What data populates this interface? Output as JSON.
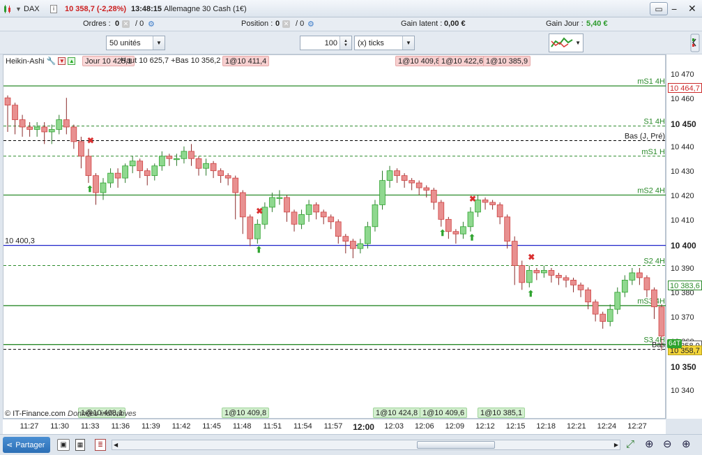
{
  "titlebar": {
    "instrument": "DAX",
    "price_change": "10 358,7 (-2,28%)",
    "time": "13:48:15",
    "name": "Allemagne 30 Cash (1€)"
  },
  "posbar": {
    "orders_label": "Ordres :",
    "orders_value": "0",
    "orders_total": "/ 0",
    "position_label": "Position :",
    "position_value": "0",
    "position_total": "/ 0",
    "gain_latent_label": "Gain latent :",
    "gain_latent_value": "0,00 €",
    "gain_jour_label": "Gain Jour :",
    "gain_jour_value": "5,40 €"
  },
  "controls": {
    "units_select": "50 unités",
    "quantity_value": "100",
    "ticks_select": "(x) ticks"
  },
  "chart_header": {
    "indicator": "Heikin-Ashi",
    "overlay_text": "Jour 10 425,1",
    "overlay_text2": "Haut 10 625,7 +Bas 10 356,2",
    "sell_tags": [
      "1@10 411,4",
      "1@10 409,8",
      "1@10 422,6",
      "1@10 385,9"
    ],
    "buy_tags": [
      "1@10 408,1",
      "1@10 409,8",
      "1@10 424,8",
      "1@10 409,6",
      "1@10 385,1"
    ]
  },
  "levels": [
    {
      "label": "mS1 4H",
      "value": 10465.9,
      "color": "#2a8a2a",
      "style": "solid"
    },
    {
      "label": "S1 4H",
      "value": 10449.4,
      "color": "#2a8a2a",
      "style": "dashed"
    },
    {
      "label": "Bas (J, Pré)",
      "value": 10443.4,
      "color": "#000000",
      "style": "dashed"
    },
    {
      "label": "mS1 H",
      "value": 10437.0,
      "color": "#2a8a2a",
      "style": "dashed"
    },
    {
      "label": "mS2 4H",
      "value": 10421.0,
      "color": "#2a8a2a",
      "style": "solid"
    },
    {
      "label": "10 400,3",
      "value": 10400.3,
      "color": "#1f24c9",
      "style": "solid"
    },
    {
      "label": "S2 4H",
      "value": 10392.0,
      "color": "#2a8a2a",
      "style": "dashed"
    },
    {
      "label": "mS3 4H",
      "value": 10375.5,
      "color": "#2a8a2a",
      "style": "solid"
    },
    {
      "label": "S3 4H",
      "value": 10359.5,
      "color": "#2a8a2a",
      "style": "solid"
    },
    {
      "label": "Bas",
      "value": 10357.5,
      "color": "#000000",
      "style": "dashed"
    }
  ],
  "yaxis": {
    "ticks": [
      "10 470",
      "10 460",
      "10 450",
      "10 440",
      "10 430",
      "10 420",
      "10 410",
      "10 400",
      "10 390",
      "10 380",
      "10 370",
      "10 360",
      "10 350",
      "10 340"
    ],
    "tick_values": [
      10470,
      10460,
      10450,
      10440,
      10430,
      10420,
      10410,
      10400,
      10390,
      10380,
      10370,
      10360,
      10350,
      10340
    ],
    "boxes": [
      {
        "text": "10 464,7",
        "value": 10464.7,
        "color": "#cc2b2b"
      },
      {
        "text": "10 383,6",
        "value": 10383.6,
        "color": "#2a8a2a"
      },
      {
        "text": "10 358,9",
        "value": 10358.9,
        "color": "#555555"
      },
      {
        "text": "10 358,7",
        "value": 10356.7,
        "color": "#555555"
      }
    ],
    "bar_count_tag": "64T"
  },
  "xaxis": {
    "labels": [
      "11:27",
      "11:30",
      "11:33",
      "11:36",
      "11:39",
      "11:42",
      "11:45",
      "11:48",
      "11:51",
      "11:54",
      "11:57",
      "12:00",
      "12:03",
      "12:06",
      "12:09",
      "12:12",
      "12:15",
      "12:18",
      "12:21",
      "12:24",
      "12:27"
    ]
  },
  "footer": {
    "copyright": "© IT-Finance.com",
    "note": "Données indicatives",
    "share_label": "Partager"
  },
  "chart_data": {
    "type": "candlestick",
    "ylim": [
      10335,
      10478
    ],
    "candles": [
      [
        10461,
        10458,
        10448,
        10462,
        10447
      ],
      [
        10458,
        10452,
        10447,
        10459,
        10446
      ],
      [
        10452,
        10449,
        10446,
        10454,
        10445
      ],
      [
        10449,
        10448,
        10446,
        10451,
        10445
      ],
      [
        10448,
        10449,
        10446,
        10451,
        10445
      ],
      [
        10449,
        10447,
        10444,
        10451,
        10442
      ],
      [
        10447,
        10448,
        10443,
        10450,
        10442
      ],
      [
        10448,
        10452,
        10447,
        10454,
        10446
      ],
      [
        10452,
        10449,
        10447,
        10461,
        10446
      ],
      [
        10449,
        10443,
        10441,
        10450,
        10440
      ],
      [
        10443,
        10437,
        10434,
        10445,
        10432
      ],
      [
        10437,
        10429,
        10427,
        10440,
        10426
      ],
      [
        10429,
        10422,
        10420,
        10430,
        10417
      ],
      [
        10422,
        10426,
        10420,
        10428,
        10419
      ],
      [
        10426,
        10430,
        10425,
        10432,
        10424
      ],
      [
        10430,
        10428,
        10425,
        10432,
        10424
      ],
      [
        10428,
        10433,
        10427,
        10434,
        10426
      ],
      [
        10433,
        10435,
        10431,
        10437,
        10430
      ],
      [
        10435,
        10431,
        10429,
        10436,
        10428
      ],
      [
        10431,
        10429,
        10426,
        10432,
        10425
      ],
      [
        10429,
        10433,
        10428,
        10434,
        10427
      ],
      [
        10433,
        10437,
        10432,
        10439,
        10431
      ],
      [
        10437,
        10436,
        10434,
        10438,
        10433
      ],
      [
        10436,
        10436,
        10434,
        10438,
        10433
      ],
      [
        10436,
        10439,
        10435,
        10441,
        10434
      ],
      [
        10439,
        10436,
        10434,
        10442,
        10433
      ],
      [
        10436,
        10432,
        10430,
        10437,
        10429
      ],
      [
        10432,
        10434,
        10430,
        10436,
        10429
      ],
      [
        10434,
        10431,
        10429,
        10435,
        10428
      ],
      [
        10431,
        10429,
        10427,
        10432,
        10426
      ],
      [
        10429,
        10428,
        10426,
        10430,
        10425
      ],
      [
        10428,
        10422,
        10412,
        10429,
        10411
      ],
      [
        10422,
        10412,
        10407,
        10423,
        10405
      ],
      [
        10412,
        10403,
        10401,
        10413,
        10400
      ],
      [
        10403,
        10409,
        10402,
        10411,
        10401
      ],
      [
        10409,
        10416,
        10408,
        10418,
        10407
      ],
      [
        10416,
        10420,
        10415,
        10422,
        10414
      ],
      [
        10420,
        10420,
        10418,
        10423,
        10417
      ],
      [
        10420,
        10414,
        10411,
        10421,
        10410
      ],
      [
        10414,
        10409,
        10407,
        10415,
        10406
      ],
      [
        10409,
        10413,
        10408,
        10415,
        10407
      ],
      [
        10413,
        10417,
        10411,
        10419,
        10410
      ],
      [
        10417,
        10414,
        10412,
        10418,
        10411
      ],
      [
        10414,
        10412,
        10410,
        10415,
        10409
      ],
      [
        10412,
        10410,
        10408,
        10413,
        10407
      ],
      [
        10410,
        10404,
        10402,
        10411,
        10401
      ],
      [
        10404,
        10402,
        10399,
        10405,
        10397
      ],
      [
        10402,
        10399,
        10396,
        10403,
        10395
      ],
      [
        10399,
        10401,
        10398,
        10403,
        10397
      ],
      [
        10401,
        10408,
        10400,
        10410,
        10399
      ],
      [
        10408,
        10417,
        10407,
        10419,
        10406
      ],
      [
        10417,
        10427,
        10416,
        10431,
        10415
      ],
      [
        10427,
        10431,
        10425,
        10433,
        10424
      ],
      [
        10431,
        10429,
        10427,
        10432,
        10426
      ],
      [
        10429,
        10427,
        10425,
        10430,
        10424
      ],
      [
        10427,
        10426,
        10424,
        10428,
        10423
      ],
      [
        10426,
        10424,
        10422,
        10427,
        10421
      ],
      [
        10424,
        10423,
        10421,
        10425,
        10420
      ],
      [
        10423,
        10418,
        10416,
        10424,
        10415
      ],
      [
        10418,
        10411,
        10409,
        10419,
        10408
      ],
      [
        10411,
        10406,
        10404,
        10412,
        10403
      ],
      [
        10406,
        10405,
        10402,
        10407,
        10401
      ],
      [
        10405,
        10408,
        10404,
        10410,
        10403
      ],
      [
        10408,
        10414,
        10407,
        10416,
        10406
      ],
      [
        10414,
        10419,
        10413,
        10421,
        10412
      ],
      [
        10419,
        10418,
        10416,
        10420,
        10415
      ],
      [
        10418,
        10417,
        10416,
        10419,
        10415
      ],
      [
        10417,
        10412,
        10410,
        10418,
        10409
      ],
      [
        10412,
        10402,
        10400,
        10413,
        10399
      ],
      [
        10402,
        10392,
        10389,
        10404,
        10384
      ],
      [
        10392,
        10385,
        10383,
        10394,
        10382
      ],
      [
        10385,
        10390,
        10384,
        10392,
        10383
      ],
      [
        10390,
        10389,
        10387,
        10391,
        10386
      ],
      [
        10389,
        10390,
        10388,
        10392,
        10387
      ],
      [
        10390,
        10388,
        10386,
        10391,
        10385
      ],
      [
        10388,
        10387,
        10385,
        10389,
        10384
      ],
      [
        10387,
        10386,
        10384,
        10388,
        10383
      ],
      [
        10386,
        10384,
        10382,
        10387,
        10381
      ],
      [
        10384,
        10382,
        10380,
        10385,
        10379
      ],
      [
        10382,
        10377,
        10375,
        10383,
        10374
      ],
      [
        10377,
        10372,
        10370,
        10378,
        10369
      ],
      [
        10372,
        10369,
        10367,
        10373,
        10366
      ],
      [
        10369,
        10374,
        10368,
        10376,
        10367
      ],
      [
        10374,
        10381,
        10373,
        10383,
        10372
      ],
      [
        10381,
        10386,
        10380,
        10388,
        10379
      ],
      [
        10386,
        10389,
        10385,
        10391,
        10384
      ],
      [
        10389,
        10387,
        10385,
        10391,
        10384
      ],
      [
        10387,
        10382,
        10380,
        10388,
        10379
      ],
      [
        10382,
        10375,
        10372,
        10383,
        10370
      ],
      [
        10375,
        10363,
        10359,
        10376,
        10357
      ]
    ]
  }
}
